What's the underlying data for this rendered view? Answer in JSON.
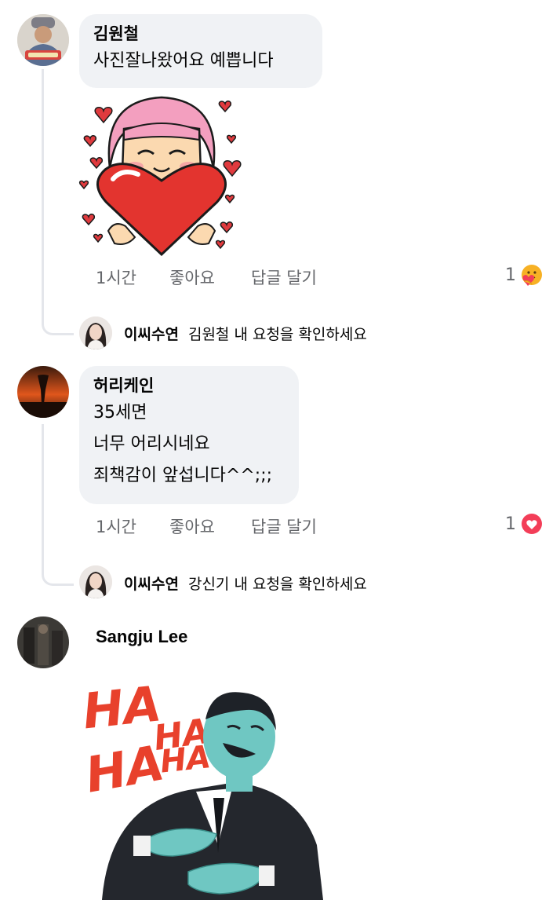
{
  "comments": [
    {
      "author": "김원철",
      "lines": [
        "사진잘나왔어요 예쁩니다"
      ],
      "time": "1시간",
      "like_label": "좋아요",
      "reply_label": "답글 달기",
      "reaction_count": "1",
      "reaction_icon": "care-emoji-icon",
      "sticker": "heart-girl-sticker",
      "reply_preview": {
        "name": "이씨수연",
        "text": "김원철 내 요청을 확인하세요"
      }
    },
    {
      "author": "허리케인",
      "lines": [
        "35세면",
        "너무 어리시네요",
        "죄책감이 앞섭니다^^;;;"
      ],
      "time": "1시간",
      "like_label": "좋아요",
      "reply_label": "답글 달기",
      "reaction_count": "1",
      "reaction_icon": "love-heart-icon",
      "reply_preview": {
        "name": "이씨수연",
        "text": "강신기 내 요청을 확인하세요"
      }
    },
    {
      "author": "Sangju Lee",
      "sticker": "haha-laughing-man-sticker",
      "sticker_text": [
        "HA",
        "HA",
        "HA",
        "HA"
      ]
    }
  ],
  "colors": {
    "bubble": "#f0f2f5",
    "meta": "#65676b",
    "love": "#f33e58",
    "sticker_red": "#e8412c"
  }
}
